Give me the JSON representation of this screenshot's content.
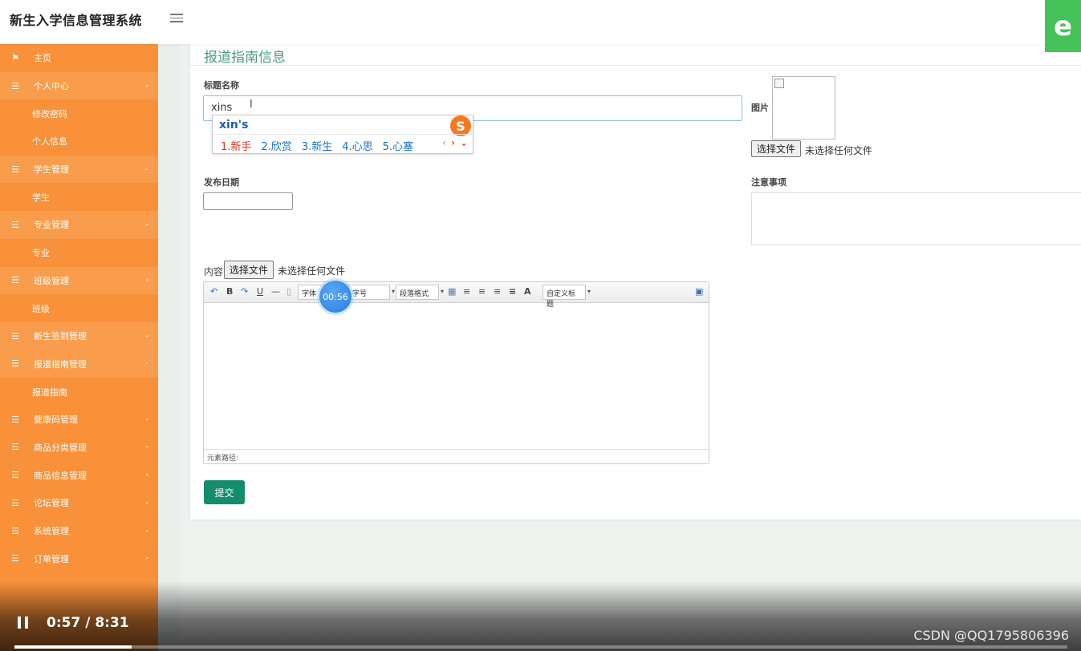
{
  "app": {
    "title": "新生入学信息管理系统",
    "badge_letter": "e"
  },
  "sidebar": {
    "items": [
      {
        "label": "主页",
        "kind": "group",
        "icon": "flag-icon",
        "glyph": "⚑",
        "caret": ""
      },
      {
        "label": "个人中心",
        "kind": "group",
        "icon": "list-icon",
        "glyph": "☰",
        "caret": "-"
      },
      {
        "label": "修改密码",
        "kind": "sub"
      },
      {
        "label": "个人信息",
        "kind": "sub"
      },
      {
        "label": "学生管理",
        "kind": "group",
        "icon": "list-icon",
        "glyph": "☰",
        "caret": "-"
      },
      {
        "label": "学生",
        "kind": "sub"
      },
      {
        "label": "专业管理",
        "kind": "group",
        "icon": "list-icon",
        "glyph": "☰",
        "caret": "-"
      },
      {
        "label": "专业",
        "kind": "sub"
      },
      {
        "label": "班级管理",
        "kind": "group",
        "icon": "list-icon",
        "glyph": "☰",
        "caret": "-"
      },
      {
        "label": "班级",
        "kind": "sub"
      },
      {
        "label": "新生签到管理",
        "kind": "group",
        "icon": "list-icon",
        "glyph": "☰",
        "caret": "-"
      },
      {
        "label": "报道指南管理",
        "kind": "group",
        "icon": "list-icon",
        "glyph": "☰",
        "caret": "-"
      },
      {
        "label": "报道指南",
        "kind": "sub"
      },
      {
        "label": "健康码管理",
        "kind": "group",
        "icon": "list-icon",
        "glyph": "☰",
        "caret": "-"
      },
      {
        "label": "商品分类管理",
        "kind": "group",
        "icon": "list-icon",
        "glyph": "☰",
        "caret": "-"
      },
      {
        "label": "商品信息管理",
        "kind": "group",
        "icon": "list-icon",
        "glyph": "☰",
        "caret": "-"
      },
      {
        "label": "论坛管理",
        "kind": "group",
        "icon": "list-icon",
        "glyph": "☰",
        "caret": "-"
      },
      {
        "label": "系统管理",
        "kind": "group",
        "icon": "list-icon",
        "glyph": "☰",
        "caret": "-"
      },
      {
        "label": "订单管理",
        "kind": "group",
        "icon": "list-icon",
        "glyph": "☰",
        "caret": "-"
      }
    ]
  },
  "form": {
    "section_title": "报道指南信息",
    "title_label": "标题名称",
    "title_value": "xins",
    "image_label": "图片",
    "file_button": "选择文件",
    "no_file_text": "未选择任何文件",
    "date_label": "发布日期",
    "notes_label": "注意事项",
    "content_label": "内容",
    "submit_label": "提交"
  },
  "ime": {
    "composition": "xin's",
    "logo": "S",
    "candidates": [
      "1.新手",
      "2.欣赏",
      "3.新生",
      "4.心思",
      "5.心塞"
    ],
    "prev": "‹",
    "next": "›",
    "expand": "⌄"
  },
  "editor": {
    "toolbar": {
      "undo": "↶",
      "bold": "B",
      "redo": "↷",
      "underline": "U",
      "hr": "—",
      "doc": "▯",
      "font_family": "字体",
      "font_size": "字号",
      "paragraph": "段落格式",
      "table": "▦",
      "align_left": "≡",
      "align_right": "≡",
      "align_center": "≡",
      "justify": "≡",
      "font_color": "A",
      "custom_title": "自定义标题",
      "fullscreen": "▣"
    },
    "status_path": "元素路径:"
  },
  "overlay": {
    "timer_bubble": "00:56",
    "video_time": "0:57 / 8:31",
    "watermark": "CSDN @QQ1795806396",
    "progress_fraction": 0.111
  }
}
